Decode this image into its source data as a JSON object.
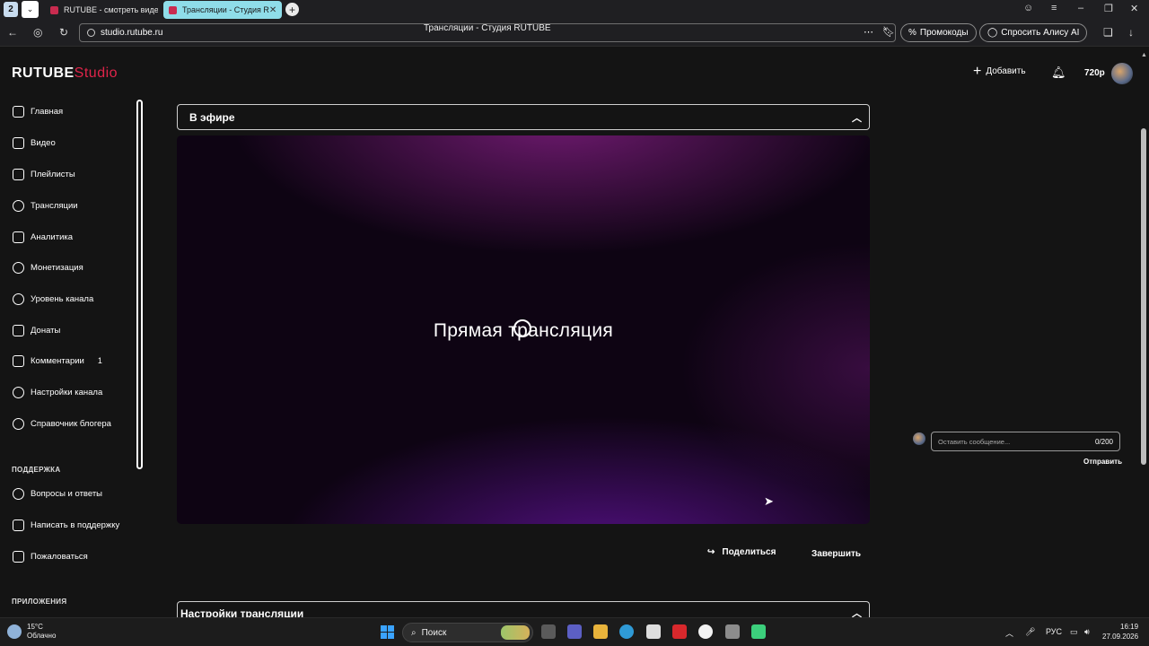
{
  "browser": {
    "tab_count": "2",
    "tabs": [
      {
        "label": "RUTUBE - смотреть виде"
      },
      {
        "label": "Трансляции - Студия R"
      }
    ],
    "url": "studio.rutube.ru",
    "page_title": "Трансляции - Студия RUTUBE",
    "promo_label": "Промокоды",
    "alice_label": "Спросить Алису AI"
  },
  "header": {
    "logo_main": "RUTUBE",
    "logo_sub": "Studio",
    "add_label": "Добавить",
    "resolution": "720p"
  },
  "sidebar": {
    "items": [
      {
        "label": "Главная"
      },
      {
        "label": "Видео"
      },
      {
        "label": "Плейлисты"
      },
      {
        "label": "Трансляции"
      },
      {
        "label": "Аналитика"
      },
      {
        "label": "Монетизация"
      },
      {
        "label": "Уровень канала"
      },
      {
        "label": "Донаты"
      },
      {
        "label": "Комментарии",
        "badge": "1"
      },
      {
        "label": "Настройки канала"
      },
      {
        "label": "Справочник блогера"
      }
    ],
    "support_title": "ПОДДЕРЖКА",
    "support_items": [
      {
        "label": "Вопросы и ответы"
      },
      {
        "label": "Написать в поддержку"
      },
      {
        "label": "Пожаловаться"
      }
    ],
    "apps_title": "ПРИЛОЖЕНИЯ"
  },
  "main": {
    "live_section_title": "В эфире",
    "player_title": "Прямая трансляция",
    "share_label": "Поделиться",
    "end_label": "Завершить",
    "settings_section_title": "Настройки трансляции"
  },
  "chat": {
    "placeholder": "Оставить сообщение...",
    "counter": "0/200",
    "send_label": "Отправить"
  },
  "taskbar": {
    "temperature": "15°C",
    "weather": "Облачно",
    "search_label": "Поиск",
    "language": "РУС",
    "time": "16:19",
    "date": "27.09.2026"
  }
}
